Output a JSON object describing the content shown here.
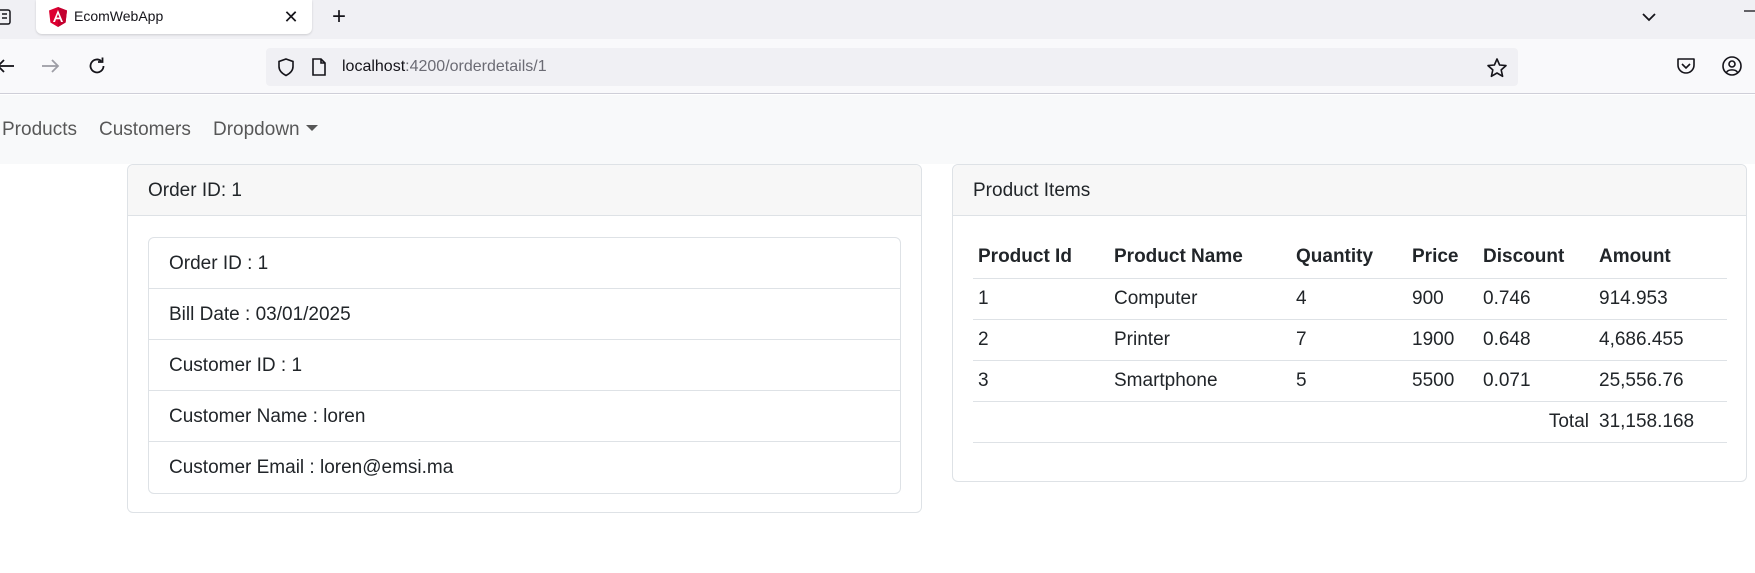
{
  "browser": {
    "tab_title": "EcomWebApp",
    "tab_close": "✕",
    "new_tab": "+",
    "url_host": "localhost",
    "url_path": ":4200/orderdetails/1"
  },
  "navbar": {
    "links": [
      "Products",
      "Customers"
    ],
    "dropdown_label": "Dropdown"
  },
  "order": {
    "header": "Order ID: 1",
    "fields": [
      "Order ID : 1",
      "Bill Date : 03/01/2025",
      "Customer ID : 1",
      "Customer Name : loren",
      "Customer Email : loren@emsi.ma"
    ]
  },
  "items": {
    "header": "Product Items",
    "columns": [
      "Product Id",
      "Product Name",
      "Quantity",
      "Price",
      "Discount",
      "Amount"
    ],
    "rows": [
      [
        "1",
        "Computer",
        "4",
        "900",
        "0.746",
        "914.953"
      ],
      [
        "2",
        "Printer",
        "7",
        "1900",
        "0.648",
        "4,686.455"
      ],
      [
        "3",
        "Smartphone",
        "5",
        "5500",
        "0.071",
        "25,556.76"
      ]
    ],
    "total_label": "Total",
    "total_value": "31,158.168"
  },
  "colors": {
    "angular_logo": "#dd0031",
    "card_border": "#dee2e6"
  },
  "icons": {
    "tab_side": "sidebar-icon",
    "tab_logo": "angular-logo-icon",
    "tab_list": "chevron-down-icon",
    "back": "back-arrow-icon",
    "forward": "forward-arrow-icon",
    "reload": "reload-icon",
    "shield": "shield-icon",
    "page": "page-icon",
    "star": "star-icon",
    "pocket": "pocket-icon",
    "account": "account-icon"
  }
}
